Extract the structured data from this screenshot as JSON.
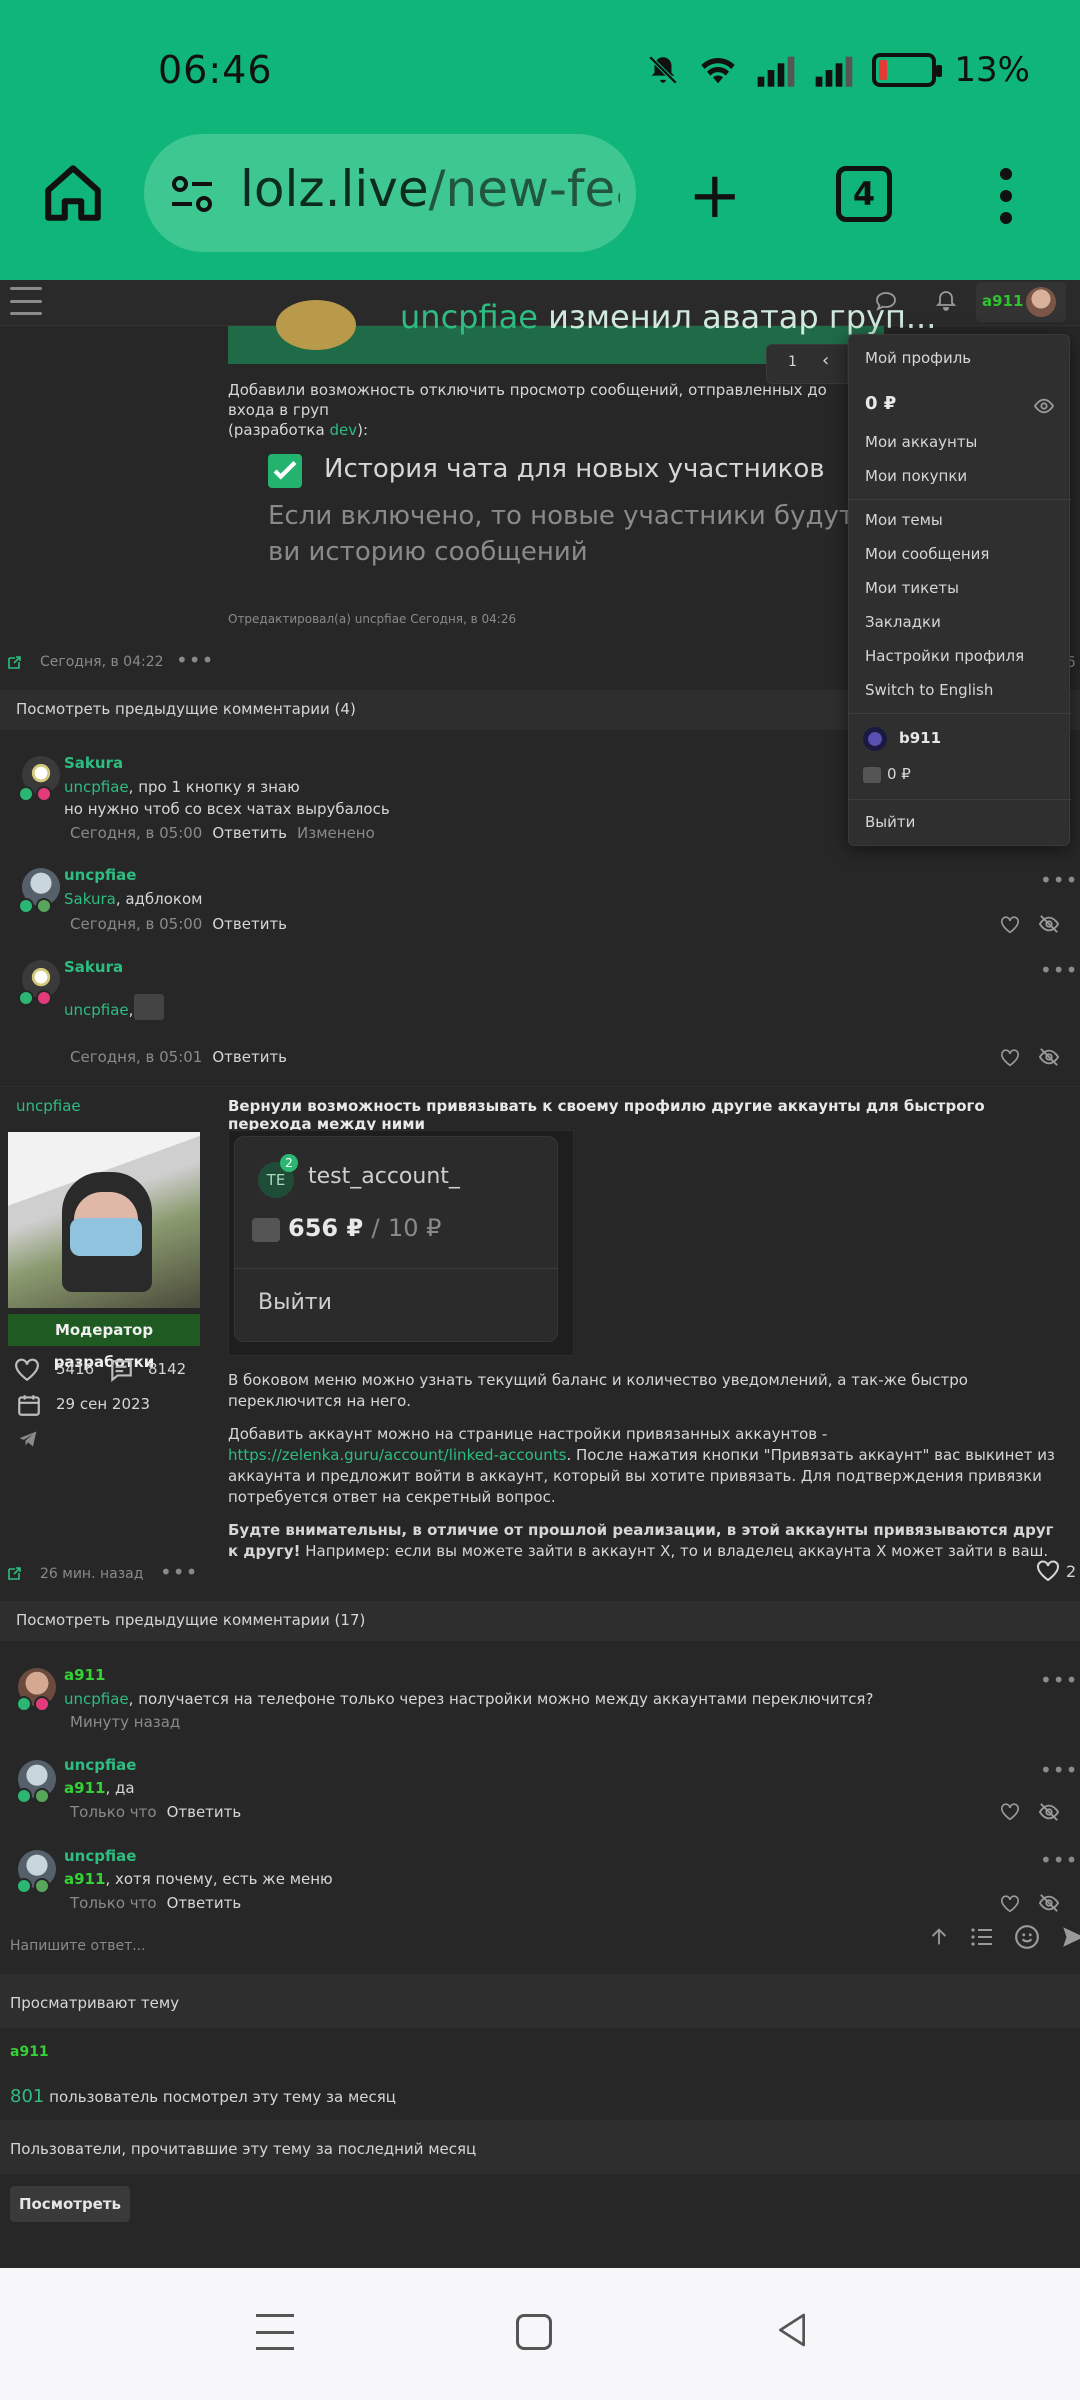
{
  "status": {
    "time": "06:46",
    "battery": "13%"
  },
  "browser": {
    "url_host": "lolz.live",
    "url_path": "/new-featu",
    "tabs_count": "4"
  },
  "header": {
    "username": "a911"
  },
  "post1": {
    "banner_text": "изменил аватар груп...",
    "banner_prefix": "uncpfiae",
    "description": "Добавили возможность отключить просмотр сообщений, отправленных до входа в груп",
    "description_dev": "(разработка",
    "dev_link": "dev",
    "checkbox_label": "История чата для новых участников",
    "checkbox_desc": "Если включено, то новые участники будут ви историю сообщений",
    "edited": "Отредактировал(а) uncpfiae Сегодня, в 04:26",
    "time": "Сегодня, в 04:22",
    "like_count": "6"
  },
  "dropdown": {
    "pager_page": "1",
    "pager_prev": "‹",
    "my_profile": "Мой профиль",
    "balance": "0 ₽",
    "my_accounts": "Мои аккаунты",
    "my_purchases": "Мои покупки",
    "my_threads": "Мои темы",
    "my_messages": "Мои сообщения",
    "my_tickets": "Мои тикеты",
    "bookmarks": "Закладки",
    "profile_settings": "Настройки профиля",
    "switch_lang": "Switch to English",
    "linked_name": "b911",
    "linked_balance": "0 ₽",
    "logout": "Выйти"
  },
  "comments1": {
    "show_prev": "Посмотреть предыдущие комментарии (4)",
    "items": [
      {
        "author": "Sakura",
        "mention": "uncpfiae",
        "text": ", про 1 кнопку я знаю",
        "text2": "но нужно чтоб со всех чатах вырубалось",
        "time": "Сегодня, в 05:00",
        "reply": "Ответить",
        "changed": "Изменено"
      },
      {
        "author": "uncpfiae",
        "mention": "Sakura",
        "text": ", адблоком",
        "time": "Сегодня, в 05:00",
        "reply": "Ответить"
      },
      {
        "author": "Sakura",
        "mention": "uncpfiae",
        "text": ",",
        "time": "Сегодня, в 05:01",
        "reply": "Ответить"
      }
    ]
  },
  "post2": {
    "author": "uncpfiae",
    "role": "Модератор разработки",
    "likes": "5416",
    "messages": "8142",
    "joined": "29 сен 2023",
    "title": "Вернули возможность привязывать к своему профилю другие аккаунты для быстрого перехода между ними",
    "card_te": "TE",
    "card_badge": "2",
    "card_name": "test_account_",
    "card_balance": "656 ₽",
    "card_sep": "/",
    "card_balance2": "10 ₽",
    "card_logout": "Выйти",
    "para1": "В боковом меню можно узнать текущий баланс и количество уведомлений, а так-же быстро переключится на него.",
    "para2a": "Добавить аккаунт можно на странице настройки привязанных аккаунтов - ",
    "para2_link": "https://zelenka.guru/account/linked-accounts",
    "para2b": ". После нажатия кнопки \"Привязать аккаунт\" вас выкинет из аккаунта и предложит войти в аккаунт, который вы хотите привязать. Для подтверждения привязки потребуется ответ на секретный вопрос.",
    "para3_bold": "Будте внимательны, в отличие от прошлой реализации, в этой аккаунты привязываются друг к другу!",
    "para3_rest": " Например: если вы можете зайти в аккаунт X, то и владелец аккаунта X может зайти в ваш.",
    "time": "26 мин. назад",
    "like_count": "2"
  },
  "comments2": {
    "show_prev": "Посмотреть предыдущие комментарии (17)",
    "items": [
      {
        "author": "a911",
        "mention": "uncpfiae",
        "text": ", получается на телефоне только через настройки можно между аккаунтами переключится?",
        "time": "Минуту назад"
      },
      {
        "author": "uncpfiae",
        "mention": "a911",
        "text": ", да",
        "time": "Только что",
        "reply": "Ответить"
      },
      {
        "author": "uncpfiae",
        "mention": "a911",
        "text": ", хотя почему, есть же меню",
        "time": "Только что",
        "reply": "Ответить"
      }
    ]
  },
  "reply": {
    "placeholder": "Напишите ответ..."
  },
  "viewers": {
    "title": "Просматривают тему",
    "user": "a911",
    "count": "801",
    "count_text": "пользователь посмотрел эту тему за месяц",
    "read_title": "Пользователи, прочитавшие эту тему за последний месяц",
    "view_button": "Посмотреть"
  },
  "colors": {
    "accent": "#10b57a",
    "link": "#2ebd80",
    "username_green": "#34d234",
    "bg": "#272727"
  }
}
